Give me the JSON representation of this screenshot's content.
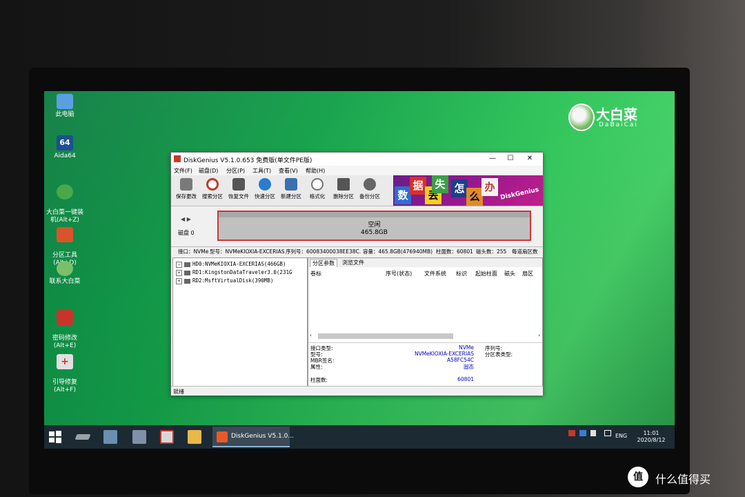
{
  "desktop": {
    "icons": [
      {
        "label": "此电脑",
        "color": "#5aa0e0"
      },
      {
        "label": "Aida64",
        "color": "#1d4f91"
      },
      {
        "label": "大白菜一键装\n机(Alt+Z)",
        "color": "#4aa84a"
      },
      {
        "label": "分区工具\n(Alt+D)",
        "color": "#d9532b"
      },
      {
        "label": "联系大白菜",
        "color": "#7ac06a"
      },
      {
        "label": "密码修改\n(Alt+E)",
        "color": "#c8342c"
      },
      {
        "label": "引导修复\n(Alt+F)",
        "color": "#e0e0e0"
      }
    ],
    "brand_title": "大白菜",
    "brand_sub": "DaBaiCai"
  },
  "window": {
    "title": "DiskGenius V5.1.0.653 免费版(单文件PE版)",
    "controls": [
      "—",
      "☐",
      "✕"
    ],
    "menu": [
      "文件(F)",
      "磁盘(D)",
      "分区(P)",
      "工具(T)",
      "查看(V)",
      "帮助(H)"
    ],
    "toolbar": [
      {
        "label": "保存更改",
        "color": "#7a7a7a"
      },
      {
        "label": "搜索分区",
        "color": "#c0392b"
      },
      {
        "label": "恢复文件",
        "color": "#555"
      },
      {
        "label": "快速分区",
        "color": "#2b7bd0"
      },
      {
        "label": "新建分区",
        "color": "#3a6fb0"
      },
      {
        "label": "格式化",
        "color": "#777"
      },
      {
        "label": "删除分区",
        "color": "#555"
      },
      {
        "label": "备份分区",
        "color": "#666"
      }
    ],
    "banner_chars": [
      "数",
      "据",
      "丢",
      "失",
      "怎",
      "么",
      "办"
    ],
    "banner_tag": "DiskGenius",
    "disk_nav": "◀ ▶",
    "disk_label": "磁盘 0",
    "disk_free_label": "空闲",
    "disk_free_size": "465.8GB",
    "disk_info": {
      "interface": "接口：NVMe",
      "model": "型号：NVMeKIOXIA-EXCERIAS",
      "serial": "序列号：60083400038EE38C.",
      "capacity": "容量：465.8GB(476940MB)",
      "cylinders": "柱面数：60801",
      "heads": "磁头数：255",
      "sectors": "每道扇区数"
    },
    "tree": [
      "HD0:NVMeKIOXIA-EXCERIAS(466GB)",
      "RD1:KingstonDataTraveler3.0(231G",
      "RD2:MsftVirtualDisk(390MB)"
    ],
    "tabs": [
      "分区参数",
      "浏览文件"
    ],
    "columns": [
      "卷标",
      "序号(状态)",
      "文件系统",
      "标识",
      "起始柱面",
      "磁头",
      "扇区"
    ],
    "details": {
      "labels": [
        "接口类型:",
        "型号:",
        "MBR签名:",
        "属性:"
      ],
      "values": [
        "NVMe",
        "NVMeKIOXIA-EXCERIAS",
        "A58FC54C",
        "固态"
      ],
      "right_labels": [
        "序列号:",
        "分区表类型:"
      ],
      "cyl_label": "柱面数:",
      "cyl_value": "60801"
    },
    "status": "就绪"
  },
  "taskbar": {
    "app_label": "DiskGenius V5.1.0...",
    "lang": "ENG",
    "time": "11:01",
    "date": "2020/8/12"
  },
  "watermark": {
    "badge": "值",
    "text": "什么值得买"
  }
}
